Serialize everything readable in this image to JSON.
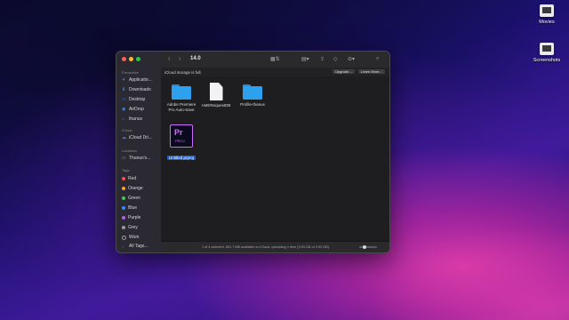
{
  "desktop": {
    "icons": [
      {
        "label": "Movies"
      },
      {
        "label": "Screenshots"
      }
    ]
  },
  "finder": {
    "path_title": "14.0",
    "colors": {
      "accent": "#1c5fcc",
      "folder": "#2ea1ee",
      "premiere": "#cc6df7"
    },
    "sidebar": {
      "favorites_header": "Favourites",
      "favorites": [
        {
          "label": "Applicatio...",
          "icon": "applications-icon"
        },
        {
          "label": "Downloads",
          "icon": "downloads-icon"
        },
        {
          "label": "Desktop",
          "icon": "desktop-icon"
        },
        {
          "label": "AirDrop",
          "icon": "airdrop-icon"
        },
        {
          "label": "thanus",
          "icon": "home-icon"
        }
      ],
      "icloud_header": "iCloud",
      "icloud": [
        {
          "label": "iCloud Dri...",
          "icon": "icloud-icon"
        }
      ],
      "locations_header": "Locations",
      "locations": [
        {
          "label": "Thanus's...",
          "icon": "laptop-icon"
        }
      ],
      "tags_header": "Tags",
      "tags": [
        {
          "label": "Red",
          "color": "#ff4b4b"
        },
        {
          "label": "Orange",
          "color": "#ff9f2e"
        },
        {
          "label": "Green",
          "color": "#3fcf4f"
        },
        {
          "label": "Blue",
          "color": "#2f8cff"
        },
        {
          "label": "Purple",
          "color": "#b45cf0"
        },
        {
          "label": "Grey",
          "color": "#9a9a9e"
        },
        {
          "label": "Work",
          "color": "#3a3a3e"
        },
        {
          "label": "All Tags...",
          "color": ""
        }
      ]
    },
    "banner": {
      "message": "iCloud storage is full.",
      "upgrade": "Upgrade...",
      "learn_more": "Learn More..."
    },
    "files": [
      {
        "label": "Adobe Premiere Pro Auto-Save",
        "type": "folder"
      },
      {
        "label": "AMERequestDB",
        "type": "document"
      },
      {
        "label": "Profile-thanus",
        "type": "folder"
      },
      {
        "label": "Untitled.prproj",
        "type": "premiere-project",
        "selected": true
      }
    ],
    "premiere_icon": {
      "mark": "Pr",
      "ext": "PROJ"
    },
    "status": "1 of 4 selected, 551.7 MB available on iCloud, uploading 1 item (3.93 GB of 3.93 GB)"
  }
}
